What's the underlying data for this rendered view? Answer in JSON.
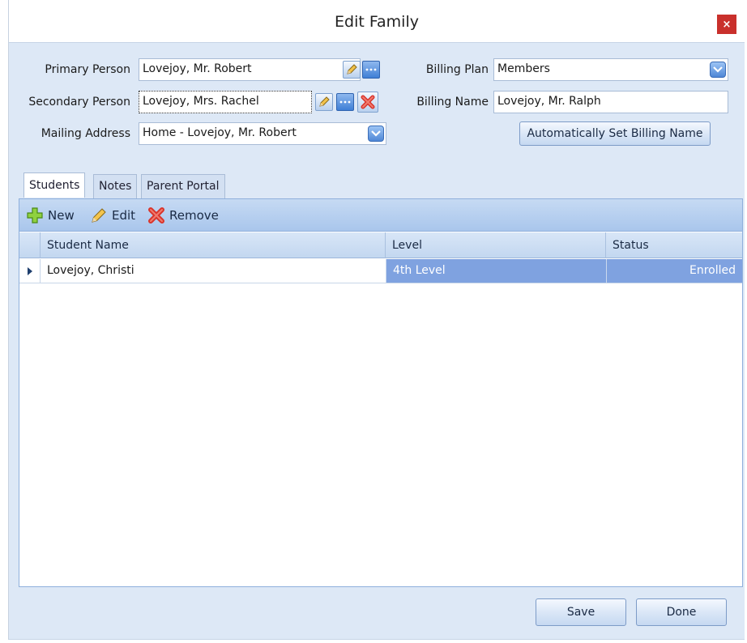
{
  "window": {
    "title": "Edit Family",
    "close_glyph": "×"
  },
  "form": {
    "primary_person": {
      "label": "Primary Person",
      "value": "Lovejoy, Mr. Robert"
    },
    "secondary_person": {
      "label": "Secondary Person",
      "value": "Lovejoy, Mrs. Rachel"
    },
    "mailing_address": {
      "label": "Mailing Address",
      "value": "Home - Lovejoy, Mr. Robert"
    },
    "billing_plan": {
      "label": "Billing Plan",
      "value": "Members"
    },
    "billing_name": {
      "label": "Billing Name",
      "value": "Lovejoy, Mr. Ralph"
    },
    "auto_billing_button": "Automatically Set Billing Name"
  },
  "tabs": [
    {
      "label": "Students",
      "active": true
    },
    {
      "label": "Notes",
      "active": false
    },
    {
      "label": "Parent Portal",
      "active": false
    }
  ],
  "toolbar": {
    "new_label": "New",
    "edit_label": "Edit",
    "remove_label": "Remove"
  },
  "grid": {
    "columns": [
      "Student Name",
      "Level",
      "Status"
    ],
    "rows": [
      {
        "student_name": "Lovejoy, Christi",
        "level": "4th Level",
        "status": "Enrolled"
      }
    ]
  },
  "footer": {
    "save_label": "Save",
    "done_label": "Done"
  },
  "colors": {
    "accent": "#7fa2e0",
    "close": "#c9302c",
    "background": "#dde8f6"
  }
}
